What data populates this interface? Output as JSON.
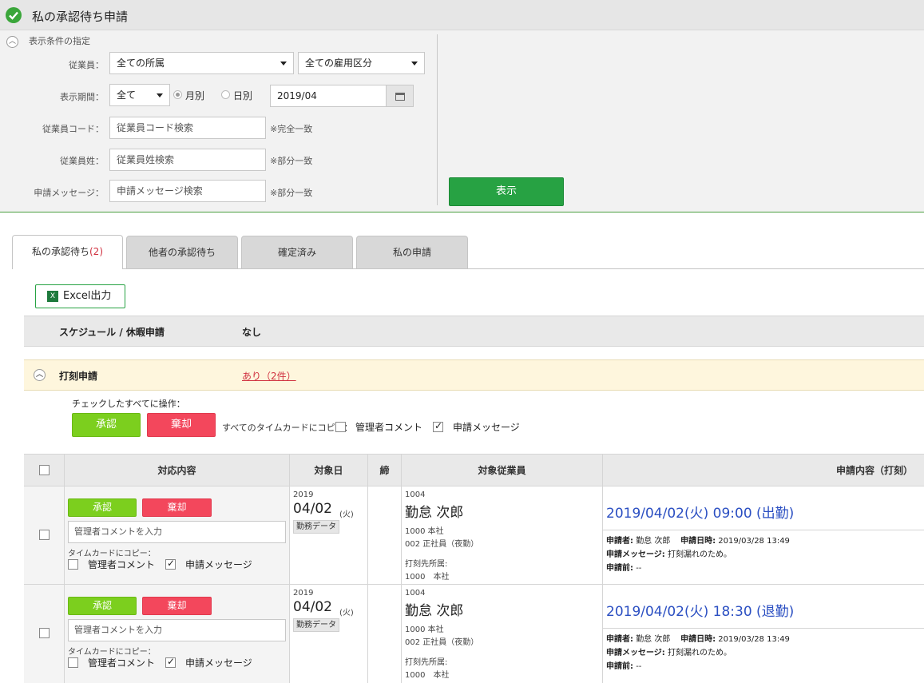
{
  "header": {
    "title": "私の承認待ち申請"
  },
  "filter": {
    "section_title": "表示条件の指定",
    "employee_label": "従業員：",
    "dept_select": "全ての所属",
    "employment_select": "全ての雇用区分",
    "period_label": "表示期間：",
    "period_select": "全て",
    "radio_monthly": "月別",
    "radio_daily": "日別",
    "month_value": "2019/04",
    "code_label": "従業員コード：",
    "code_placeholder": "従業員コード検索",
    "code_note": "※完全一致",
    "surname_label": "従業員姓：",
    "surname_placeholder": "従業員姓検索",
    "surname_note": "※部分一致",
    "message_label": "申請メッセージ：",
    "message_placeholder": "申請メッセージ検索",
    "message_note": "※部分一致",
    "show_button": "表示"
  },
  "tabs": {
    "my_pending": "私の承認待ち",
    "my_pending_count": "(2)",
    "others_pending": "他者の承認待ち",
    "confirmed": "確定済み",
    "my_requests": "私の申請"
  },
  "excel_button": "Excel出力",
  "schedule_section": {
    "label": "スケジュール / 休暇申請",
    "value": "なし"
  },
  "stamp_section": {
    "label": "打刻申請",
    "value": "あり（2件）",
    "bulk_label": "チェックしたすべてに操作：",
    "approve": "承認",
    "reject": "棄却",
    "copy_label": "すべてのタイムカードにコピー：",
    "admin_comment": "管理者コメント",
    "request_message": "申請メッセージ"
  },
  "table": {
    "headers": {
      "action": "対応内容",
      "date": "対象日",
      "close": "締",
      "employee": "対象従業員",
      "content": "申請内容（打刻）"
    },
    "rows": [
      {
        "approve": "承認",
        "reject": "棄却",
        "comment_placeholder": "管理者コメントを入力",
        "copy_label": "タイムカードにコピー：",
        "admin_comment": "管理者コメント",
        "request_message": "申請メッセージ",
        "year": "2019",
        "date": "04/02",
        "weekday": "(火)",
        "work_data": "勤務データ",
        "emp_code": "1004",
        "emp_name": "勤怠 次郎",
        "dept": "1000 本社",
        "emp_type": "002 正社員（夜勤）",
        "stamp_dept_label": "打刻先所属:",
        "stamp_dept": "1000　本社",
        "request_title": "2019/04/02(火) 09:00 (出勤)",
        "requester_label": "申請者:",
        "requester": "勤怠 次郎",
        "request_datetime_label": "申請日時:",
        "request_datetime": "2019/03/28 13:49",
        "message_label": "申請メッセージ:",
        "message": "打刻漏れのため。",
        "before_label": "申請前:",
        "before": "--"
      },
      {
        "approve": "承認",
        "reject": "棄却",
        "comment_placeholder": "管理者コメントを入力",
        "copy_label": "タイムカードにコピー：",
        "admin_comment": "管理者コメント",
        "request_message": "申請メッセージ",
        "year": "2019",
        "date": "04/02",
        "weekday": "(火)",
        "work_data": "勤務データ",
        "emp_code": "1004",
        "emp_name": "勤怠 次郎",
        "dept": "1000 本社",
        "emp_type": "002 正社員（夜勤）",
        "stamp_dept_label": "打刻先所属:",
        "stamp_dept": "1000　本社",
        "request_title": "2019/04/02(火) 18:30 (退勤)",
        "requester_label": "申請者:",
        "requester": "勤怠 次郎",
        "request_datetime_label": "申請日時:",
        "request_datetime": "2019/03/28 13:49",
        "message_label": "申請メッセージ:",
        "message": "打刻漏れのため。",
        "before_label": "申請前:",
        "before": "--"
      }
    ]
  },
  "colors": {
    "accent_green": "#27a243",
    "approve_green": "#7ccf1e",
    "reject_red": "#f3475c",
    "link_blue": "#2b4fc2"
  }
}
